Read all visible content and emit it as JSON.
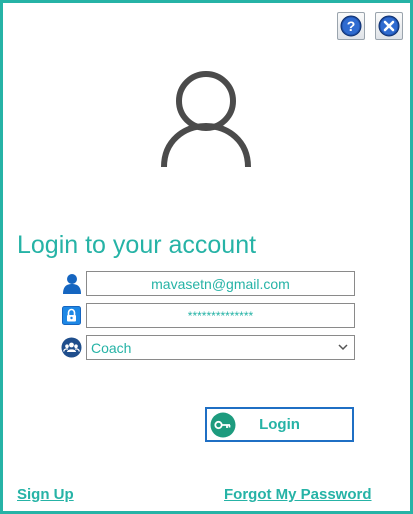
{
  "colors": {
    "accent": "#26b3a6",
    "focus_border": "#1f6fc4",
    "icon_blue": "#1565c0"
  },
  "toolbar": {
    "help_icon": "question-mark-icon",
    "close_icon": "close-x-icon"
  },
  "hero": {
    "icon": "user-silhouette-icon"
  },
  "title": "Login to your account",
  "fields": {
    "email": {
      "icon": "person-icon",
      "value": "mavasetn@gmail.com"
    },
    "password": {
      "icon": "lock-icon",
      "value": "**************"
    },
    "role": {
      "icon": "group-icon",
      "value": "Coach"
    }
  },
  "login_button": {
    "label": "Login",
    "icon": "key-icon"
  },
  "links": {
    "sign_up": "Sign Up",
    "forgot_password": "Forgot My Password"
  }
}
